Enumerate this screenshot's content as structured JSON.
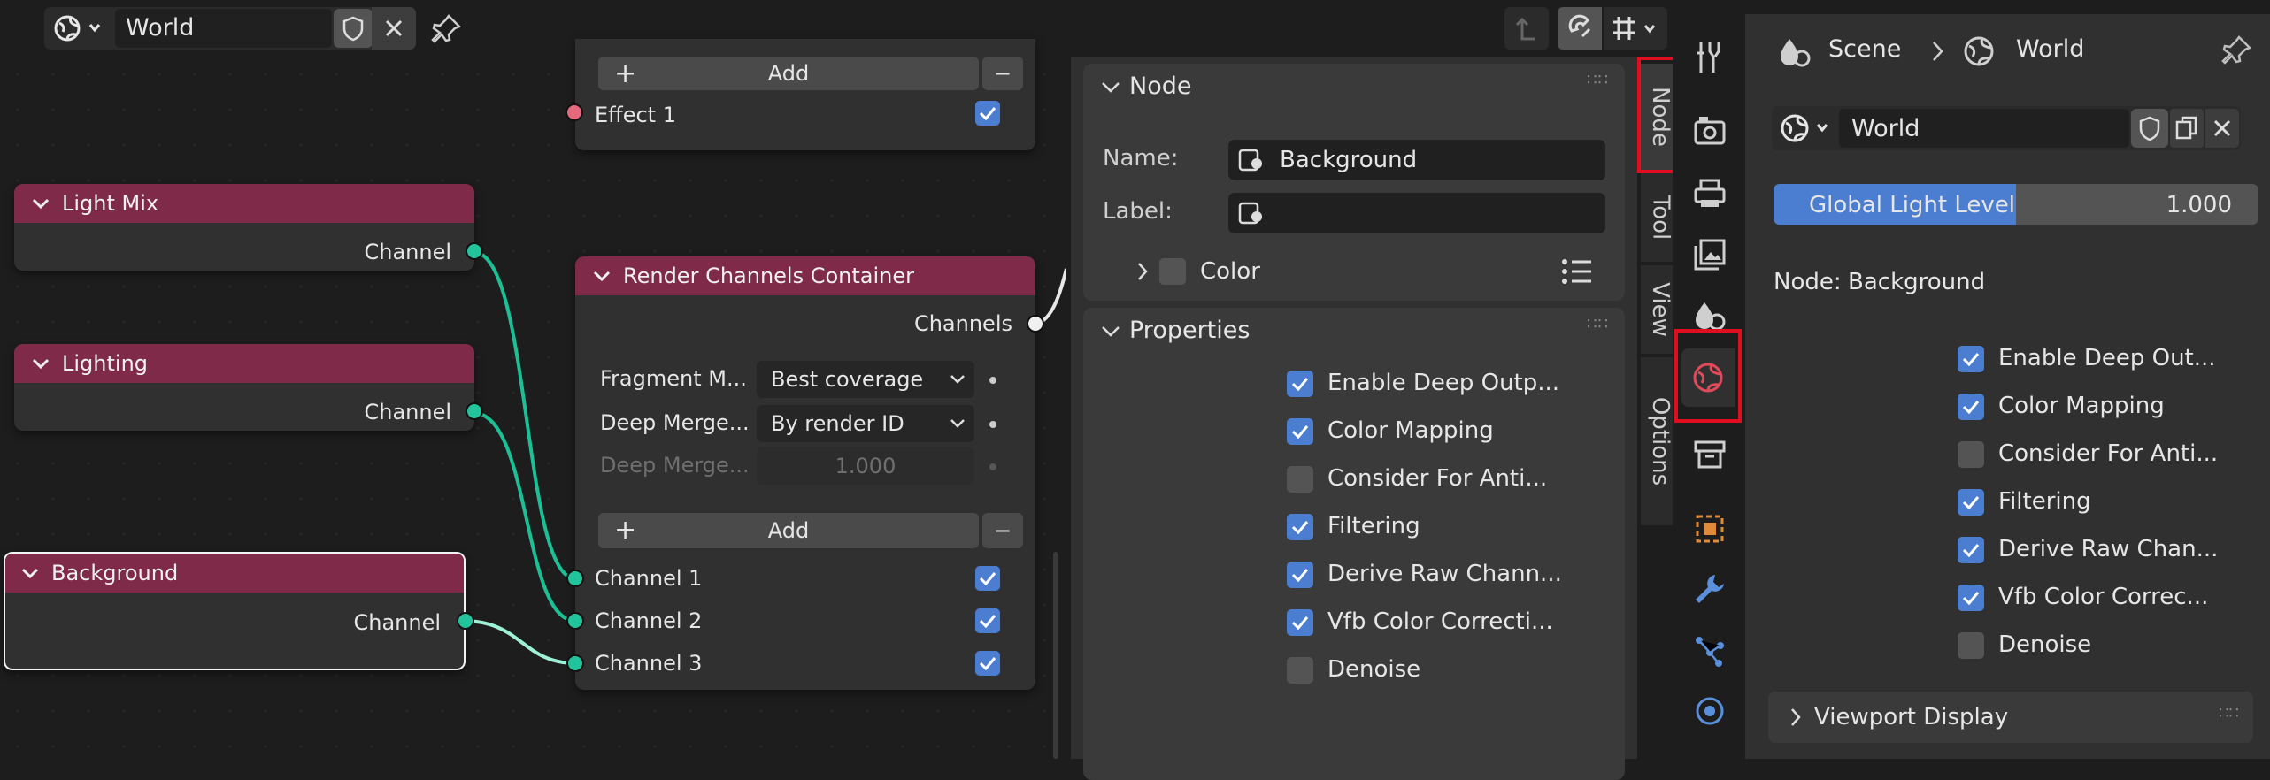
{
  "header": {
    "world_name": "World"
  },
  "nodes": {
    "top_partial": {
      "add_label": "Add",
      "remove_label": "−",
      "effect_label": "Effect 1",
      "effect_checked": true
    },
    "light_mix": {
      "title": "Light Mix",
      "output_label": "Channel"
    },
    "lighting": {
      "title": "Lighting",
      "output_label": "Channel"
    },
    "background": {
      "title": "Background",
      "output_label": "Channel"
    },
    "render_channels": {
      "title": "Render Channels Container",
      "output_label": "Channels",
      "fields": [
        {
          "label": "Fragment M...",
          "value": "Best coverage"
        },
        {
          "label": "Deep Merge...",
          "value": "By render ID"
        },
        {
          "label": "Deep Merge...",
          "value": "1.000"
        }
      ],
      "add_label": "Add",
      "remove_label": "−",
      "channels": [
        {
          "label": "Channel 1",
          "checked": true
        },
        {
          "label": "Channel 2",
          "checked": true
        },
        {
          "label": "Channel 3",
          "checked": true
        }
      ]
    }
  },
  "npanel": {
    "node_section": {
      "title": "Node",
      "name_label": "Name:",
      "name_value": "Background",
      "label_label": "Label:",
      "label_value": "",
      "color_label": "Color"
    },
    "properties_section": {
      "title": "Properties",
      "items": [
        {
          "label": "Enable Deep Outp...",
          "checked": true
        },
        {
          "label": "Color Mapping",
          "checked": true
        },
        {
          "label": "Consider For Anti...",
          "checked": false
        },
        {
          "label": "Filtering",
          "checked": true
        },
        {
          "label": "Derive Raw Chann...",
          "checked": true
        },
        {
          "label": "Vfb Color Correcti...",
          "checked": true
        },
        {
          "label": "Denoise",
          "checked": false
        }
      ]
    },
    "tabs": [
      "Node",
      "Tool",
      "View",
      "Options"
    ]
  },
  "properties": {
    "breadcrumb": {
      "scene": "Scene",
      "world": "World"
    },
    "world_name": "World",
    "global_light_label": "Global Light Level",
    "global_light_value": "1.000",
    "global_light_fraction": 0.5,
    "node_label": "Node:",
    "node_value": "Background",
    "items": [
      {
        "label": "Enable Deep Out...",
        "checked": true
      },
      {
        "label": "Color Mapping",
        "checked": true
      },
      {
        "label": "Consider For Anti...",
        "checked": false
      },
      {
        "label": "Filtering",
        "checked": true
      },
      {
        "label": "Derive Raw Chan...",
        "checked": true
      },
      {
        "label": "Vfb Color Correc...",
        "checked": true
      },
      {
        "label": "Denoise",
        "checked": false
      }
    ],
    "viewport_display_label": "Viewport Display"
  },
  "colors": {
    "accent": "#4b7ed0",
    "node_header": "#7f2a48",
    "socket": "#22c49b",
    "highlight": "#e00e1f"
  }
}
